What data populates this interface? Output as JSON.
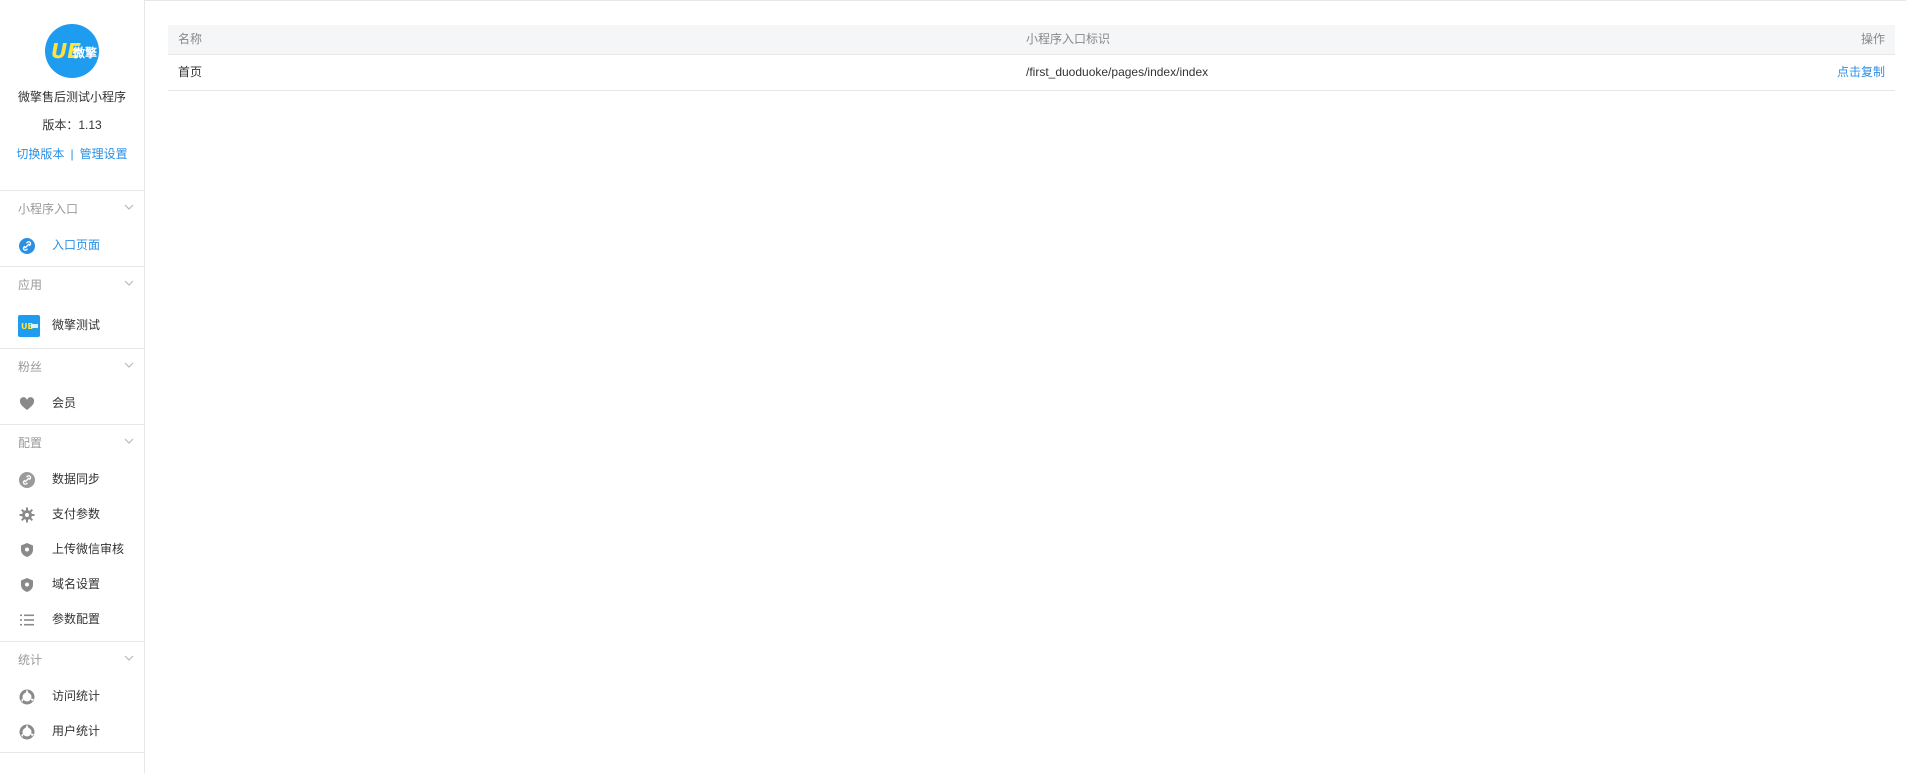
{
  "account": {
    "logo_text": "微擎",
    "name": "微擎售后测试小程序",
    "version": "版本：1.13",
    "switch_version": "切换版本",
    "separator": "|",
    "manage_settings": "管理设置"
  },
  "sidebar": {
    "groups": [
      {
        "title": "小程序入口",
        "items": [
          {
            "label": "入口页面",
            "icon": "link-icon",
            "active": true
          }
        ]
      },
      {
        "title": "应用",
        "items": [
          {
            "label": "微擎测试",
            "icon": "app-logo-icon"
          }
        ]
      },
      {
        "title": "粉丝",
        "items": [
          {
            "label": "会员",
            "icon": "heart-icon"
          }
        ]
      },
      {
        "title": "配置",
        "items": [
          {
            "label": "数据同步",
            "icon": "sync-link-icon"
          },
          {
            "label": "支付参数",
            "icon": "gear-icon"
          },
          {
            "label": "上传微信审核",
            "icon": "shield-icon"
          },
          {
            "label": "域名设置",
            "icon": "shield-icon"
          },
          {
            "label": "参数配置",
            "icon": "list-icon"
          }
        ]
      },
      {
        "title": "统计",
        "items": [
          {
            "label": "访问统计",
            "icon": "pie-chart-icon"
          },
          {
            "label": "用户统计",
            "icon": "pie-chart-icon"
          }
        ]
      }
    ]
  },
  "table": {
    "headers": [
      "名称",
      "小程序入口标识",
      "操作"
    ],
    "rows": [
      {
        "name": "首页",
        "entry": "/first_duoduoke/pages/index/index",
        "action": "点击复制"
      }
    ]
  },
  "colors": {
    "accent": "#2a90e6",
    "logo_bg": "#1e9cf0",
    "muted": "#999999",
    "border": "#e7e7e7",
    "header_bg": "#f5f6f8"
  }
}
